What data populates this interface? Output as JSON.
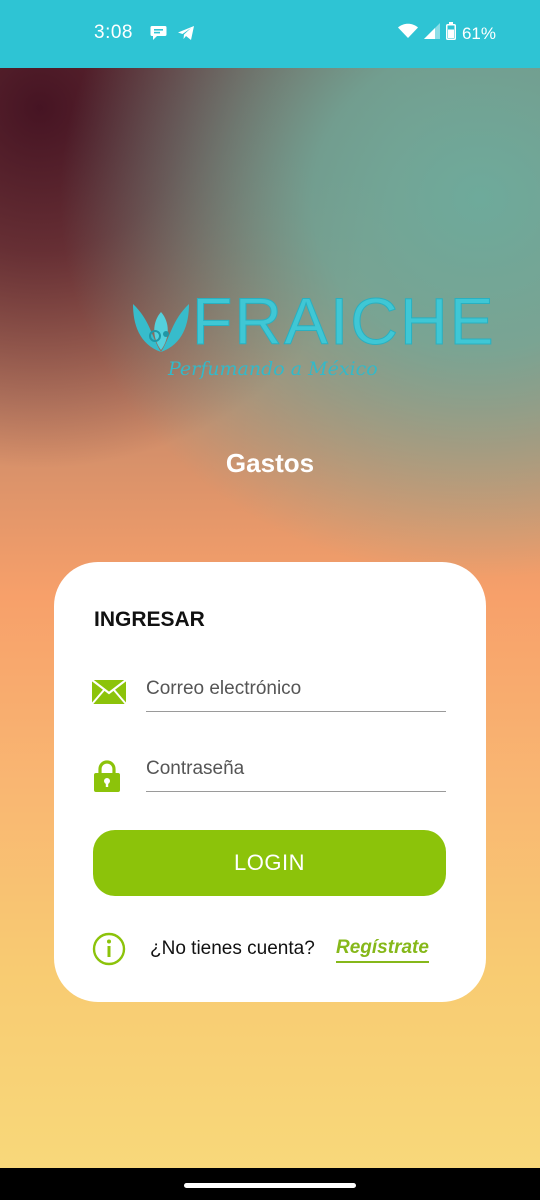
{
  "status_bar": {
    "time": "3:08",
    "left_icons": [
      "chat-bubble-icon",
      "telegram-icon"
    ],
    "right_icons": [
      "wifi-icon",
      "signal-icon",
      "battery-icon"
    ],
    "battery": "61%",
    "color": "#2ec4d4"
  },
  "logo": {
    "word": "FRAICHE",
    "tagline": "Perfumando a México",
    "color": "#3fc7d5"
  },
  "app_title": "Gastos",
  "login_card": {
    "heading": "INGRESAR",
    "email": {
      "icon": "envelope-icon",
      "placeholder": "Correo electrónico",
      "value": ""
    },
    "password": {
      "icon": "lock-icon",
      "placeholder": "Contraseña",
      "value": ""
    },
    "login_button": "LOGIN",
    "info_icon": "info-icon",
    "register_question": "¿No tienes cuenta?",
    "register_link": "Regístrate",
    "accent_color": "#8cc30a"
  }
}
